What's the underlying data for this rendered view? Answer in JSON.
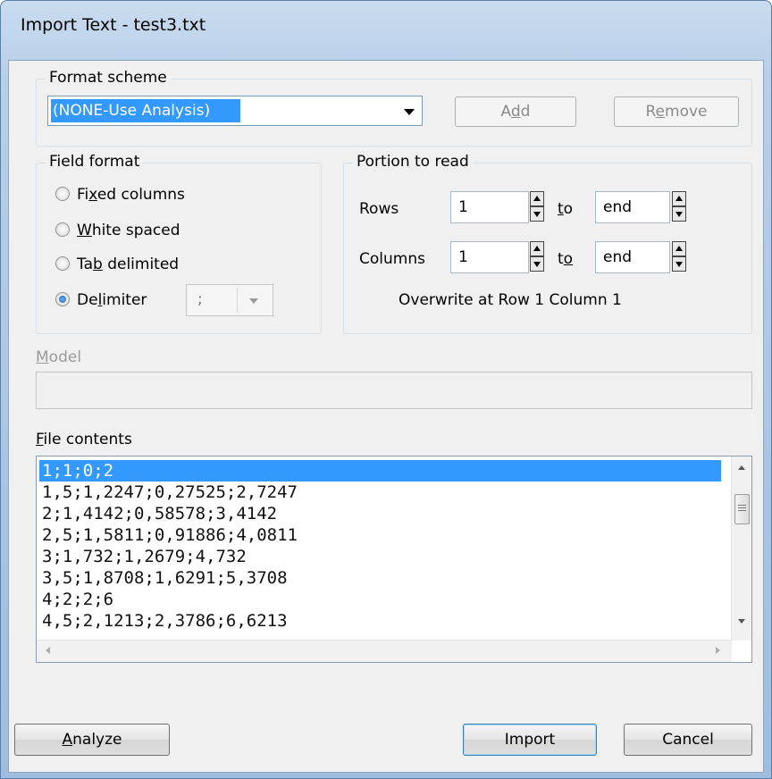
{
  "window": {
    "title": "Import Text - test3.txt"
  },
  "format_scheme": {
    "label": "Format scheme",
    "selected": "(NONE-Use Analysis)",
    "add_button": {
      "pre": "A",
      "u": "d",
      "post": "d"
    },
    "remove_button": {
      "pre": "R",
      "u": "e",
      "post": "move"
    }
  },
  "field_format": {
    "label": "Field format",
    "options": [
      {
        "pre": "Fi",
        "u": "x",
        "post": "ed columns",
        "selected": false
      },
      {
        "pre": "",
        "u": "W",
        "post": "hite spaced",
        "selected": false
      },
      {
        "pre": "Ta",
        "u": "b",
        "post": " delimited",
        "selected": false
      },
      {
        "pre": "De",
        "u": "l",
        "post": "imiter",
        "selected": true
      }
    ],
    "delimiter_value": ";"
  },
  "portion": {
    "label": "Portion to read",
    "rows": {
      "label": "Rows",
      "from": "1",
      "to_label_u": "t",
      "to_label_rest": "o",
      "to": "end"
    },
    "columns": {
      "label": "Columns",
      "from": "1",
      "to_label_pre": "t",
      "to_label_u": "o",
      "to": "end"
    },
    "overwrite_text": "Overwrite at Row 1 Column 1"
  },
  "model": {
    "label_u": "M",
    "label_rest": "odel",
    "value": ""
  },
  "file_contents": {
    "label_u": "F",
    "label_rest": "ile contents",
    "lines": [
      "1;1;0;2",
      "1,5;1,2247;0,27525;2,7247",
      "2;1,4142;0,58578;3,4142",
      "2,5;1,5811;0,91886;4,0811",
      "3;1,732;1,2679;4,732",
      "3,5;1,8708;1,6291;5,3708",
      "4;2;2;6",
      "4,5;2,1213;2,3786;6,6213"
    ],
    "selected_index": 0
  },
  "buttons": {
    "analyze": {
      "u": "A",
      "rest": "nalyze"
    },
    "import": "Import",
    "cancel": "Cancel"
  }
}
